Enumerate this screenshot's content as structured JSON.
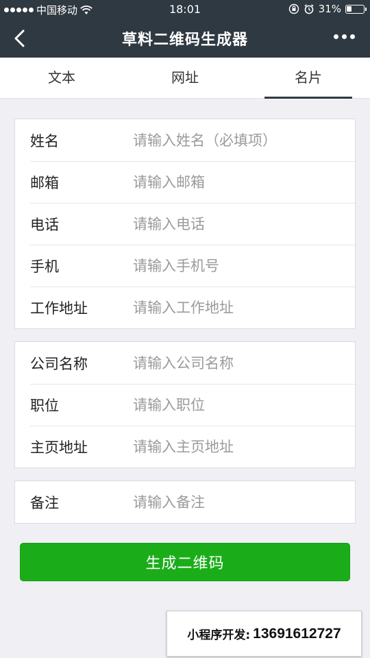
{
  "status_bar": {
    "carrier": "中国移动",
    "time": "18:01",
    "battery": "31%",
    "battery_level": 0.31,
    "signal_bars": 5
  },
  "nav": {
    "title": "草料二维码生成器"
  },
  "tabs": [
    {
      "label": "文本",
      "active": false
    },
    {
      "label": "网址",
      "active": false
    },
    {
      "label": "名片",
      "active": true
    }
  ],
  "form": {
    "group_1": [
      {
        "label": "姓名",
        "placeholder": "请输入姓名（必填项）",
        "value": ""
      },
      {
        "label": "邮箱",
        "placeholder": "请输入邮箱",
        "value": ""
      },
      {
        "label": "电话",
        "placeholder": "请输入电话",
        "value": ""
      },
      {
        "label": "手机",
        "placeholder": "请输入手机号",
        "value": ""
      },
      {
        "label": "工作地址",
        "placeholder": "请输入工作地址",
        "value": ""
      }
    ],
    "group_2": [
      {
        "label": "公司名称",
        "placeholder": "请输入公司名称",
        "value": ""
      },
      {
        "label": "职位",
        "placeholder": "请输入职位",
        "value": ""
      },
      {
        "label": "主页地址",
        "placeholder": "请输入主页地址",
        "value": ""
      }
    ],
    "group_3": [
      {
        "label": "备注",
        "placeholder": "请输入备注",
        "value": ""
      }
    ]
  },
  "generate_button": {
    "label": "生成二维码"
  },
  "contact_banner": {
    "label": "小程序开发:",
    "number": "13691612727"
  },
  "colors": {
    "header_bg": "#2f3941",
    "page_bg": "#efeff4",
    "primary_green": "#1aad19",
    "placeholder_gray": "#9a9a9a"
  },
  "icons": {
    "back": "chevron-left-icon",
    "more": "more-dots-icon",
    "wifi": "wifi-icon",
    "lock_rotation": "rotation-lock-icon",
    "alarm": "alarm-icon",
    "battery": "battery-icon"
  }
}
